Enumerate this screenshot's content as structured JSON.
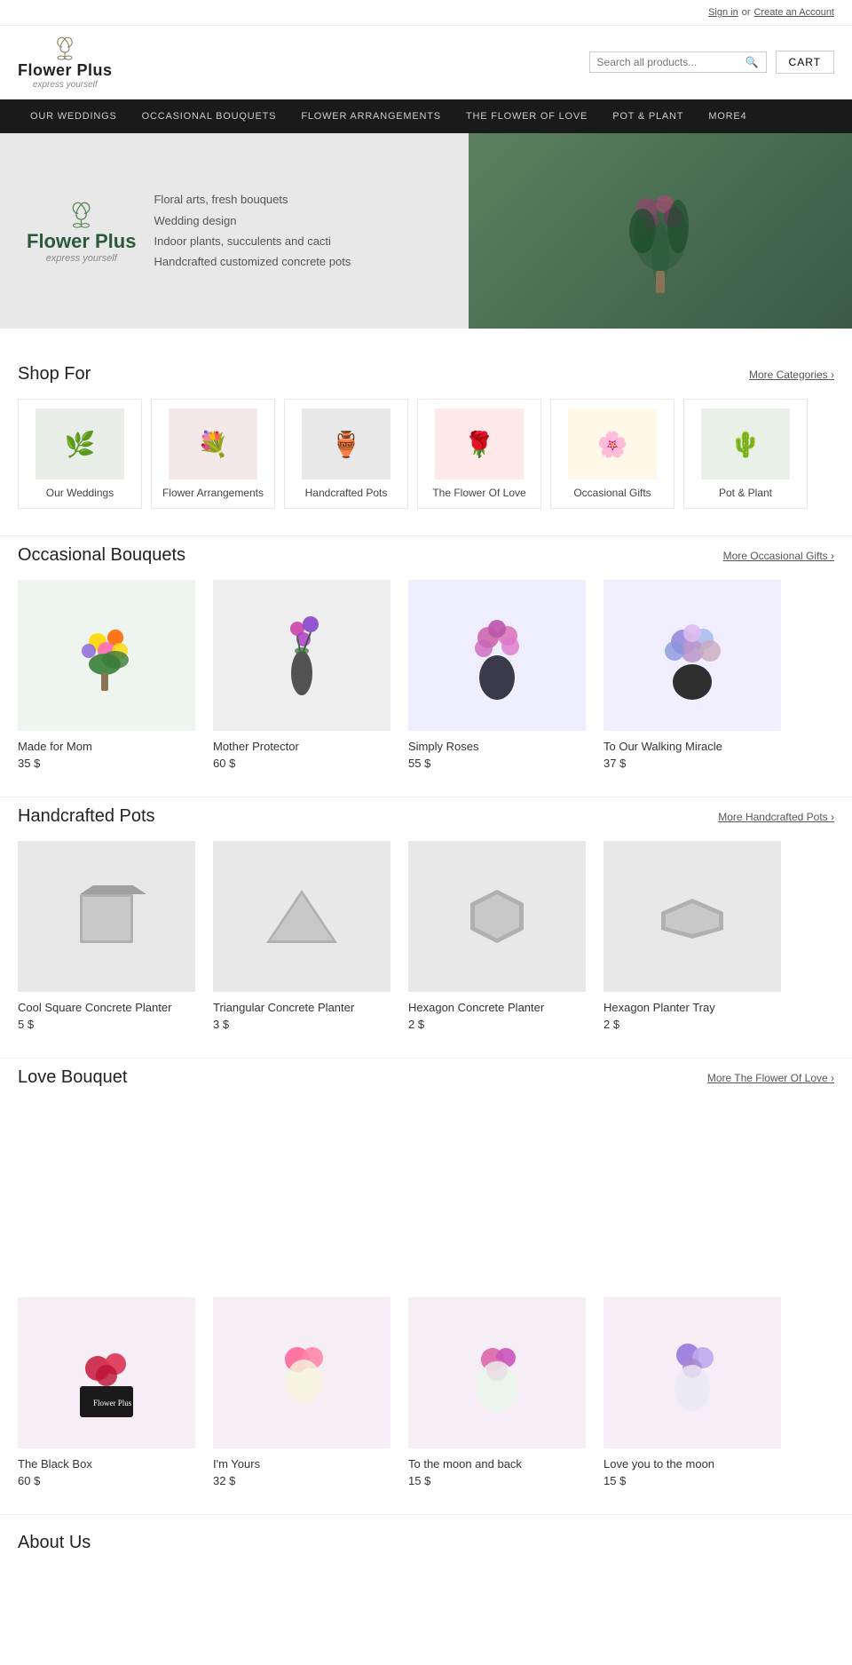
{
  "topbar": {
    "signin": "Sign in",
    "or": "or",
    "create_account": "Create an Account"
  },
  "header": {
    "logo_name": "Flower Plus",
    "logo_tagline": "express yourself",
    "search_placeholder": "Search all products...",
    "cart_label": "CART"
  },
  "nav": {
    "items": [
      {
        "label": "OUR WEDDINGS",
        "href": "#"
      },
      {
        "label": "OCCASIONAL BOUQUETS",
        "href": "#"
      },
      {
        "label": "FLOWER ARRANGEMENTS",
        "href": "#"
      },
      {
        "label": "THE FLOWER OF LOVE",
        "href": "#"
      },
      {
        "label": "POT & PLANT",
        "href": "#"
      },
      {
        "label": "MORE4",
        "href": "#"
      }
    ]
  },
  "hero": {
    "logo_name": "Flower Plus",
    "logo_tagline": "express yourself",
    "lines": [
      "Floral arts, fresh bouquets",
      "Wedding design",
      "Indoor plants, succulents and cacti",
      "Handcrafted customized concrete pots"
    ]
  },
  "shop_for": {
    "title": "Shop For",
    "more_link": "More Categories ›",
    "categories": [
      {
        "name": "Our Weddings",
        "icon": "🌿"
      },
      {
        "name": "Flower Arrangements",
        "icon": "💐"
      },
      {
        "name": "Handcrafted Pots",
        "icon": "🪴"
      },
      {
        "name": "The Flower Of Love",
        "icon": "🌹"
      },
      {
        "name": "Occasional Gifts",
        "icon": "🌸"
      },
      {
        "name": "Pot & Plant",
        "icon": "🌵"
      }
    ]
  },
  "occasional_bouquets": {
    "title": "Occasional Bouquets",
    "more_link": "More Occasional Gifts ›",
    "products": [
      {
        "name": "Made for Mom",
        "price": "35 $",
        "icon": "🌼"
      },
      {
        "name": "Mother Protector",
        "price": "60 $",
        "icon": "💐"
      },
      {
        "name": "Simply Roses",
        "price": "55 $",
        "icon": "🌷"
      },
      {
        "name": "To Our Walking Miracle",
        "price": "37 $",
        "icon": "🌸"
      }
    ]
  },
  "handcrafted_pots": {
    "title": "Handcrafted Pots",
    "more_link": "More Handcrafted Pots ›",
    "products": [
      {
        "name": "Cool Square Concrete Planter",
        "price": "5 $",
        "icon": "⬜"
      },
      {
        "name": "Triangular Concrete Planter",
        "price": "3 $",
        "icon": "🔺"
      },
      {
        "name": "Hexagon Concrete Planter",
        "price": "2 $",
        "icon": "⬡"
      },
      {
        "name": "Hexagon Planter Tray",
        "price": "2 $",
        "icon": "⬡"
      }
    ]
  },
  "love_bouquet": {
    "title": "Love Bouquet",
    "more_link": "More The Flower Of Love ›",
    "products": [
      {
        "name": "The Black Box",
        "price": "60 $",
        "icon": "🌹"
      },
      {
        "name": "I'm Yours",
        "price": "32 $",
        "icon": "💕"
      },
      {
        "name": "To the moon and back",
        "price": "15 $",
        "icon": "🌸"
      },
      {
        "name": "Love you to the moon",
        "price": "15 $",
        "icon": "🌙"
      }
    ]
  },
  "about_us": {
    "title": "About Us"
  }
}
